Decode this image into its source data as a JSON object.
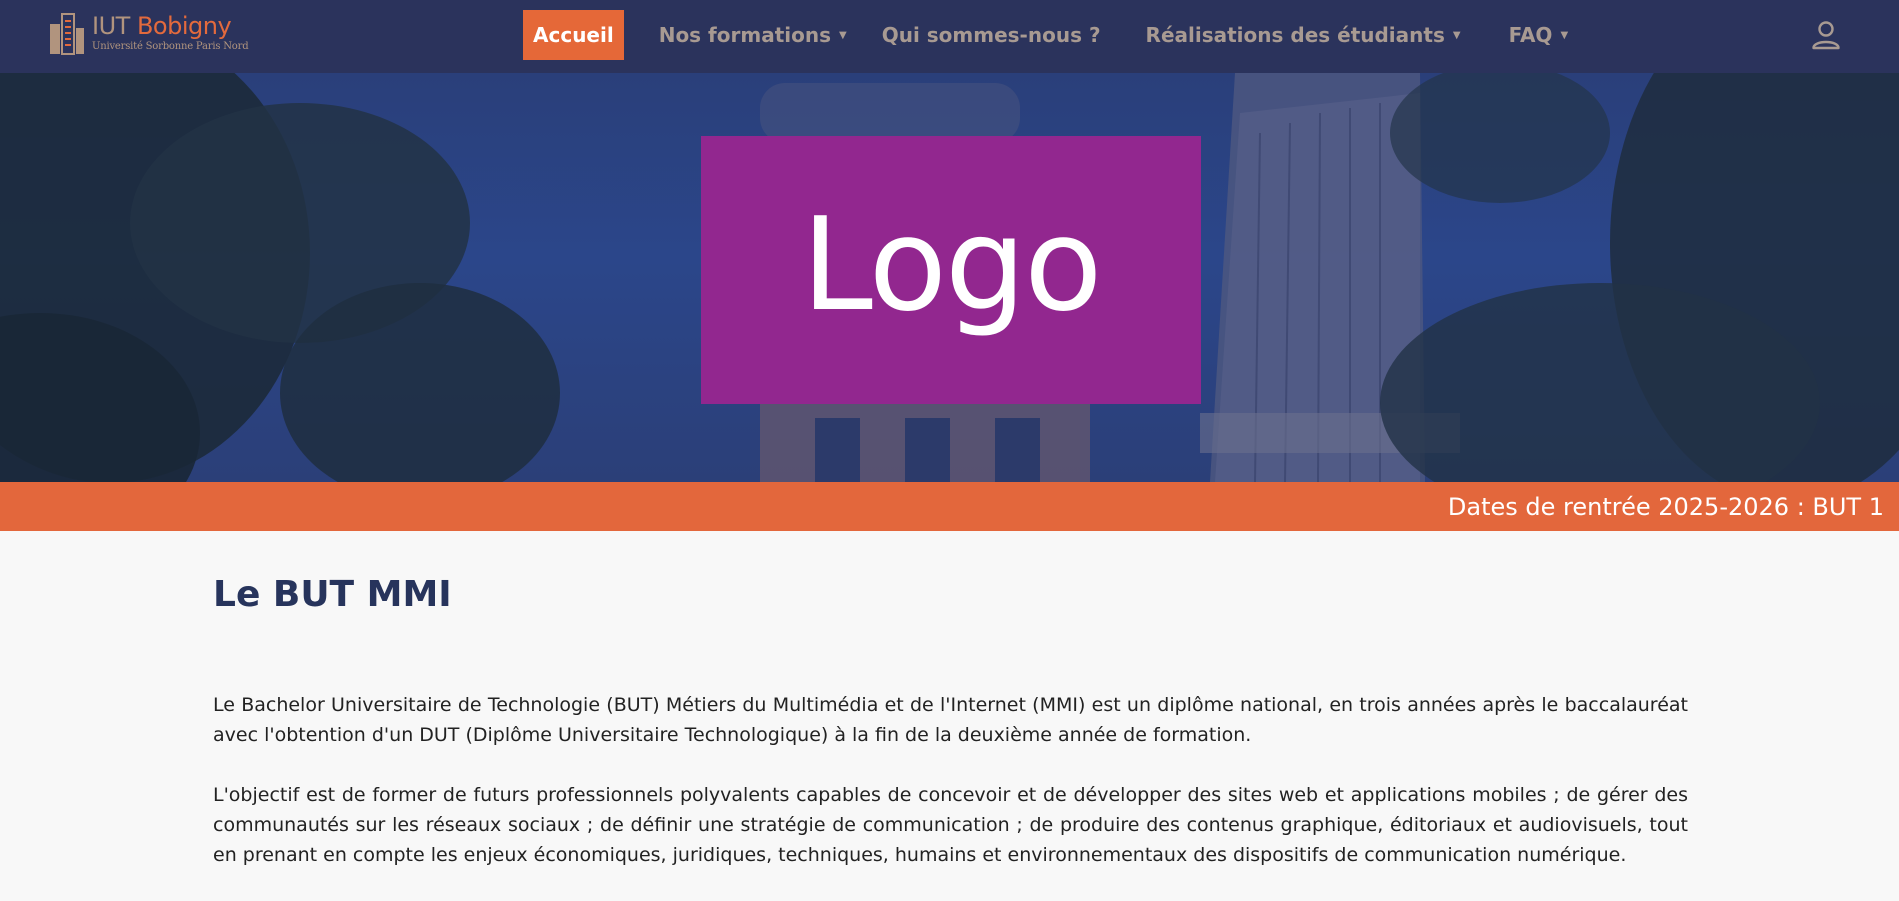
{
  "brand": {
    "name_part1": "IUT",
    "name_part2": "Bobigny",
    "subtitle": "Université Sorbonne Paris Nord"
  },
  "nav": {
    "items": [
      {
        "label": "Accueil",
        "active": true
      },
      {
        "label": "Nos formations",
        "dropdown": true
      },
      {
        "label": "Qui sommes-nous ?"
      },
      {
        "label": "Réalisations des étudiants",
        "dropdown": true
      },
      {
        "label": "FAQ",
        "dropdown": true
      }
    ],
    "caret": "▼",
    "user_icon": "user-icon"
  },
  "hero": {
    "logo_text": "Logo"
  },
  "ticker": {
    "text": "Dates de rentrée 2025-2026 : BUT 1"
  },
  "main": {
    "title": "Le BUT MMI",
    "paragraphs": [
      "Le Bachelor Universitaire de Technologie (BUT) Métiers du Multimédia et de l'Internet (MMI) est un diplôme national, en trois années après le baccalauréat avec l'obtention d'un DUT (Diplôme Universitaire Technologique) à la fin de la deuxième année de formation.",
      "L'objectif est de former de futurs professionnels polyvalents capables de concevoir et de développer des sites web et applications mobiles ; de gérer des communautés sur les réseaux sociaux ; de définir une stratégie de communication ; de produire des contenus graphique, éditoriaux et audiovisuels, tout en prenant en compte les enjeux économiques, juridiques, techniques, humains et environnementaux des dispositifs de communication numérique."
    ]
  },
  "colors": {
    "navbar": "#2b335c",
    "accent": "#e56838",
    "logo_bg": "#92278f",
    "title": "#27345c"
  }
}
